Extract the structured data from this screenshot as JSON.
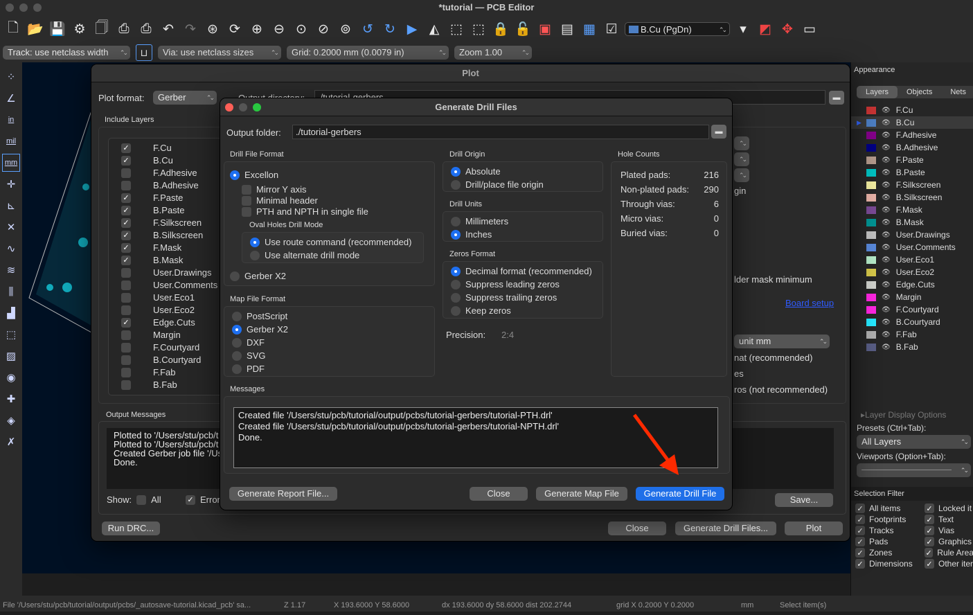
{
  "window": {
    "title": "*tutorial — PCB Editor"
  },
  "toolbar2": {
    "track": "Track: use netclass width",
    "via": "Via: use netclass sizes",
    "grid": "Grid: 0.2000 mm (0.0079 in)",
    "zoom": "Zoom 1.00",
    "layer": "B.Cu (PgDn)"
  },
  "lefttools": [
    "grid-icon",
    "polar-icon",
    "in",
    "mil",
    "mm",
    "cursor-icon",
    "measure-icon",
    "ratsnest-icon",
    "curved-ratsnest-icon",
    "net-icon",
    "highlight-icon",
    "pad-icon",
    "select-icon",
    "zones-icon",
    "via-icon",
    "pad-insert-icon",
    "layers-icon",
    "tools-icon"
  ],
  "plot": {
    "title": "Plot",
    "format_label": "Plot format:",
    "format": "Gerber",
    "outdir_label": "Output directory:",
    "outdir": "./tutorial-gerbers",
    "include_layers": "Include Layers",
    "layers": [
      {
        "name": "F.Cu",
        "checked": true
      },
      {
        "name": "B.Cu",
        "checked": true
      },
      {
        "name": "F.Adhesive",
        "checked": false
      },
      {
        "name": "B.Adhesive",
        "checked": false
      },
      {
        "name": "F.Paste",
        "checked": true
      },
      {
        "name": "B.Paste",
        "checked": true
      },
      {
        "name": "F.Silkscreen",
        "checked": true
      },
      {
        "name": "B.Silkscreen",
        "checked": true
      },
      {
        "name": "F.Mask",
        "checked": true
      },
      {
        "name": "B.Mask",
        "checked": true
      },
      {
        "name": "User.Drawings",
        "checked": false
      },
      {
        "name": "User.Comments",
        "checked": false
      },
      {
        "name": "User.Eco1",
        "checked": false
      },
      {
        "name": "User.Eco2",
        "checked": false
      },
      {
        "name": "Edge.Cuts",
        "checked": true
      },
      {
        "name": "Margin",
        "checked": false
      },
      {
        "name": "F.Courtyard",
        "checked": false
      },
      {
        "name": "B.Courtyard",
        "checked": false
      },
      {
        "name": "F.Fab",
        "checked": false
      },
      {
        "name": "B.Fab",
        "checked": false
      }
    ],
    "partial": {
      "origin": "gin",
      "mask": "lder mask minimum",
      "board_setup": "Board setup",
      "unit": "unit mm",
      "fmt": "nat (recommended)",
      "es": "es",
      "ros": "ros (not recommended)"
    },
    "output_messages": "Output Messages",
    "messages": [
      "Plotted to '/Users/stu/pcb/t",
      "Plotted to '/Users/stu/pcb/t",
      "Created Gerber job file '/Us",
      "Done."
    ],
    "show": "Show:",
    "all": "All",
    "errors": "Error",
    "run_drc": "Run DRC...",
    "close": "Close",
    "gen_drill": "Generate Drill Files...",
    "plot": "Plot",
    "save": "Save..."
  },
  "drill": {
    "title": "Generate Drill Files",
    "output_label": "Output folder:",
    "output": "./tutorial-gerbers",
    "format_title": "Drill File Format",
    "excellon": "Excellon",
    "mirror": "Mirror Y axis",
    "minimal": "Minimal header",
    "pth": "PTH and NPTH in single file",
    "oval_title": "Oval Holes Drill Mode",
    "route": "Use route command (recommended)",
    "alternate": "Use alternate drill mode",
    "gerberx2": "Gerber X2",
    "map_title": "Map File Format",
    "map_opts": [
      {
        "label": "PostScript",
        "selected": false
      },
      {
        "label": "Gerber X2",
        "selected": true
      },
      {
        "label": "DXF",
        "selected": false
      },
      {
        "label": "SVG",
        "selected": false
      },
      {
        "label": "PDF",
        "selected": false
      }
    ],
    "origin_title": "Drill Origin",
    "origin_opts": [
      {
        "label": "Absolute",
        "selected": true
      },
      {
        "label": "Drill/place file origin",
        "selected": false
      }
    ],
    "units_title": "Drill Units",
    "units_opts": [
      {
        "label": "Millimeters",
        "selected": false
      },
      {
        "label": "Inches",
        "selected": true
      }
    ],
    "zeros_title": "Zeros Format",
    "zeros_opts": [
      {
        "label": "Decimal format (recommended)",
        "selected": true
      },
      {
        "label": "Suppress leading zeros",
        "selected": false
      },
      {
        "label": "Suppress trailing zeros",
        "selected": false
      },
      {
        "label": "Keep zeros",
        "selected": false
      }
    ],
    "precision_label": "Precision:",
    "precision": "2:4",
    "hole_title": "Hole Counts",
    "holes": [
      {
        "label": "Plated pads:",
        "value": "216"
      },
      {
        "label": "Non-plated pads:",
        "value": "290"
      },
      {
        "label": "Through vias:",
        "value": "6"
      },
      {
        "label": "Micro vias:",
        "value": "0"
      },
      {
        "label": "Buried vias:",
        "value": "0"
      }
    ],
    "messages_title": "Messages",
    "messages": [
      "Created file '/Users/stu/pcb/tutorial/output/pcbs/tutorial-gerbers/tutorial-PTH.drl'",
      "Created file '/Users/stu/pcb/tutorial/output/pcbs/tutorial-gerbers/tutorial-NPTH.drl'",
      "Done."
    ],
    "report": "Generate Report File...",
    "close": "Close",
    "map": "Generate Map File",
    "generate": "Generate Drill File"
  },
  "appearance": {
    "title": "Appearance",
    "tabs": [
      "Layers",
      "Objects",
      "Nets"
    ],
    "active_tab": "Layers",
    "active_layer": "B.Cu",
    "layers": [
      {
        "name": "F.Cu",
        "color": "#c83434"
      },
      {
        "name": "B.Cu",
        "color": "#4d7fc4"
      },
      {
        "name": "F.Adhesive",
        "color": "#84008a"
      },
      {
        "name": "B.Adhesive",
        "color": "#000084"
      },
      {
        "name": "F.Paste",
        "color": "#b49a8c"
      },
      {
        "name": "B.Paste",
        "color": "#00c2c2"
      },
      {
        "name": "F.Silkscreen",
        "color": "#f2eda1"
      },
      {
        "name": "B.Silkscreen",
        "color": "#e8b2a7"
      },
      {
        "name": "F.Mask",
        "color": "#7a4a96"
      },
      {
        "name": "B.Mask",
        "color": "#009494"
      },
      {
        "name": "User.Drawings",
        "color": "#c2c2c2"
      },
      {
        "name": "User.Comments",
        "color": "#5989db"
      },
      {
        "name": "User.Eco1",
        "color": "#b5ebc9"
      },
      {
        "name": "User.Eco2",
        "color": "#d6c84a"
      },
      {
        "name": "Edge.Cuts",
        "color": "#d0d2cd"
      },
      {
        "name": "Margin",
        "color": "#ff26e2"
      },
      {
        "name": "F.Courtyard",
        "color": "#ff26e2"
      },
      {
        "name": "B.Courtyard",
        "color": "#26e9ff"
      },
      {
        "name": "F.Fab",
        "color": "#afafaf"
      },
      {
        "name": "B.Fab",
        "color": "#585d84"
      }
    ],
    "display_options": "Layer Display Options",
    "presets_label": "Presets (Ctrl+Tab):",
    "preset": "All Layers",
    "viewports_label": "Viewports (Option+Tab):",
    "selection_title": "Selection Filter",
    "filters": [
      "All items",
      "Locked it",
      "Footprints",
      "Text",
      "Tracks",
      "Vias",
      "Pads",
      "Graphics",
      "Zones",
      "Rule Area",
      "Dimensions",
      "Other iter"
    ]
  },
  "status": [
    "File '/Users/stu/pcb/tutorial/output/pcbs/_autosave-tutorial.kicad_pcb' sa...",
    "Z 1.17",
    "X 193.6000  Y 58.6000",
    "dx 193.6000  dy 58.6000  dist 202.2744",
    "grid X 0.2000  Y 0.2000",
    "mm",
    "Select item(s)"
  ],
  "colors": {
    "accent": "#1f6fe8",
    "canvas": "#001023",
    "arrow": "#ff2a00"
  }
}
